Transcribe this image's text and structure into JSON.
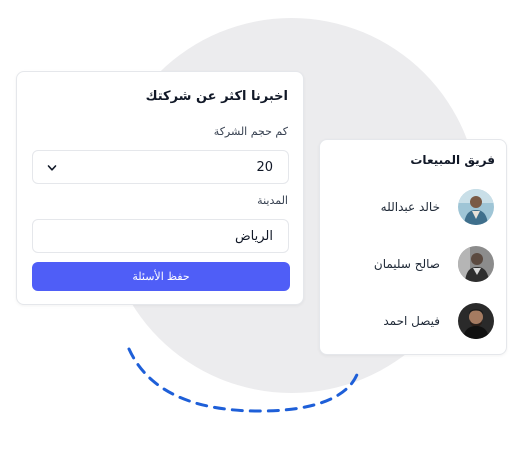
{
  "form": {
    "title": "اخبرنا اكثر عن شركتك",
    "company_size_label": "كم حجم الشركة",
    "company_size_value": "20",
    "city_label": "المدينة",
    "city_value": "الرياض",
    "submit_label": "حفظ الأسئلة"
  },
  "team": {
    "title": "فريق المبيعات",
    "members": [
      {
        "name": "خالد عبدالله",
        "avatar_icon": "person-avatar-icon"
      },
      {
        "name": "صالح سليمان",
        "avatar_icon": "person-avatar-icon"
      },
      {
        "name": "فيصل احمد",
        "avatar_icon": "person-avatar-icon"
      }
    ]
  },
  "colors": {
    "accent": "#4f5ef7",
    "background_circle": "#ececee",
    "dashed_arc": "#1e5fd8"
  }
}
